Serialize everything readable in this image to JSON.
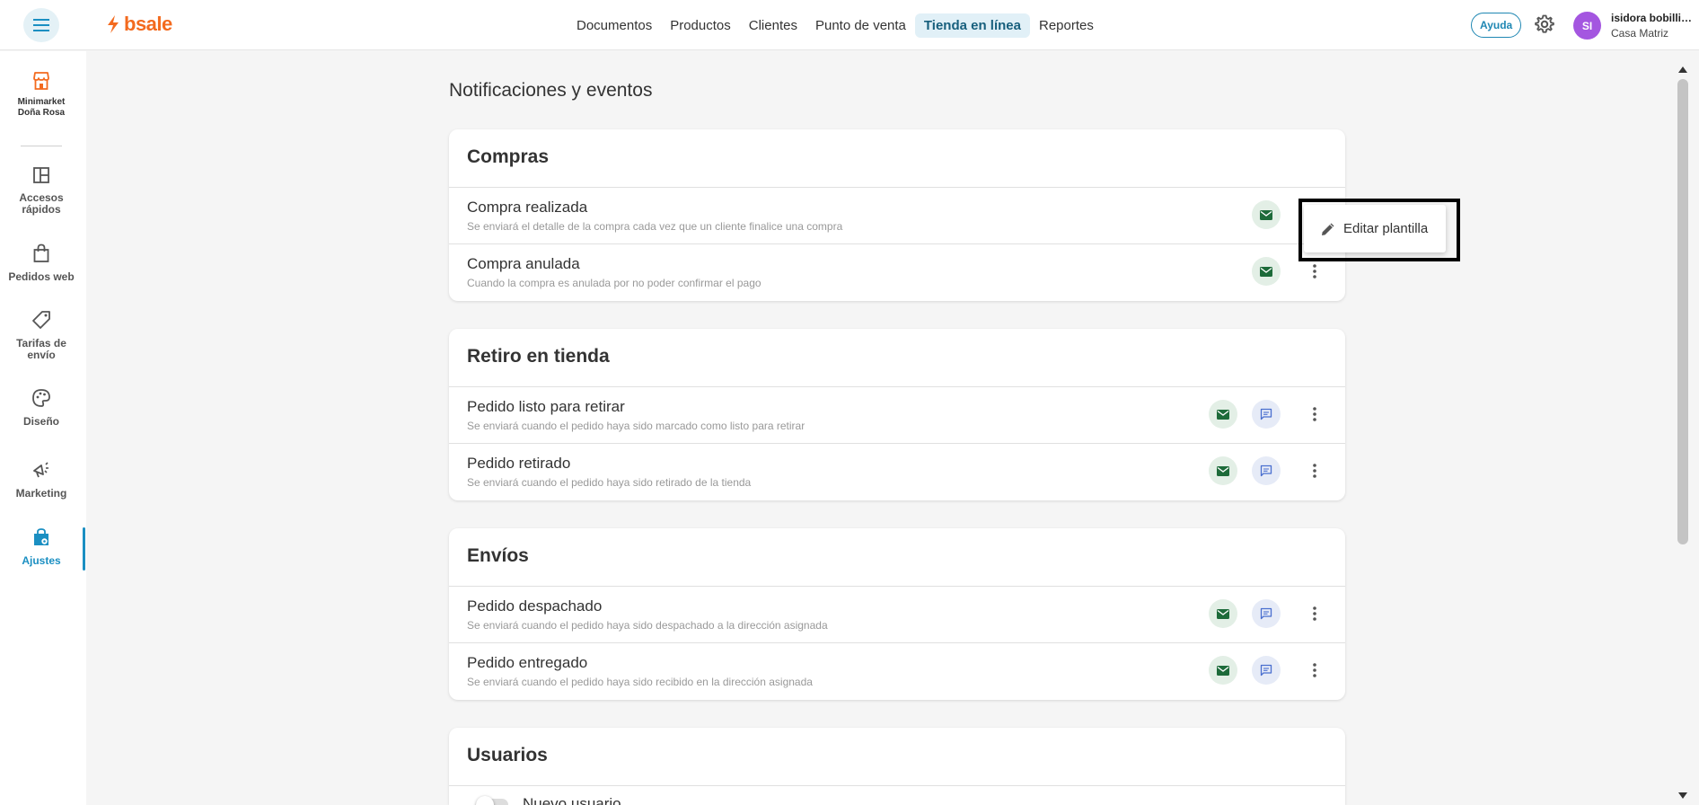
{
  "header": {
    "logo": "bsale",
    "nav": [
      {
        "label": "Documentos"
      },
      {
        "label": "Productos"
      },
      {
        "label": "Clientes"
      },
      {
        "label": "Punto de venta"
      },
      {
        "label": "Tienda en línea",
        "active": true
      },
      {
        "label": "Reportes"
      }
    ],
    "help_label": "Ayuda",
    "user_initials": "SI",
    "user_name": "isidora bobillie...",
    "user_branch": "Casa Matriz"
  },
  "sidebar": {
    "store_name_line1": "Minimarket",
    "store_name_line2": "Doña Rosa",
    "items": [
      {
        "line1": "Accesos",
        "line2": "rápidos",
        "icon": "layout-icon"
      },
      {
        "line1": "Pedidos web",
        "line2": "",
        "icon": "shopping-bag-icon"
      },
      {
        "line1": "Tarifas de",
        "line2": "envío",
        "icon": "tag-icon"
      },
      {
        "line1": "Diseño",
        "line2": "",
        "icon": "palette-icon"
      },
      {
        "line1": "Marketing",
        "line2": "",
        "icon": "megaphone-icon"
      },
      {
        "line1": "Ajustes",
        "line2": "",
        "icon": "settings-bag-icon",
        "active": true
      }
    ]
  },
  "main": {
    "title": "Notificaciones y eventos",
    "sections": [
      {
        "title": "Compras",
        "rows": [
          {
            "title": "Compra realizada",
            "desc": "Se enviará el detalle de la compra cada vez que un cliente finalice una compra"
          },
          {
            "title": "Compra anulada",
            "desc": "Cuando la compra es anulada por no poder confirmar el pago"
          }
        ]
      },
      {
        "title": "Retiro en tienda",
        "rows": [
          {
            "title": "Pedido listo para retirar",
            "desc": "Se enviará cuando el pedido haya sido marcado como listo para retirar"
          },
          {
            "title": "Pedido retirado",
            "desc": "Se enviará cuando el pedido haya sido retirado de la tienda"
          }
        ]
      },
      {
        "title": "Envíos",
        "rows": [
          {
            "title": "Pedido despachado",
            "desc": "Se enviará cuando el pedido haya sido despachado a la dirección asignada"
          },
          {
            "title": "Pedido entregado",
            "desc": "Se enviará cuando el pedido haya sido recibido en la dirección asignada"
          }
        ]
      },
      {
        "title": "Usuarios",
        "rows": [
          {
            "title": "Nuevo usuario",
            "desc": ""
          }
        ]
      }
    ]
  },
  "popup": {
    "label": "Editar plantilla"
  },
  "colors": {
    "brand": "#f36a1e",
    "accent": "#1b8fc2",
    "mail_icon": "#1d6b3a",
    "chat_icon": "#4a6fcf",
    "avatar": "#a456e0"
  }
}
